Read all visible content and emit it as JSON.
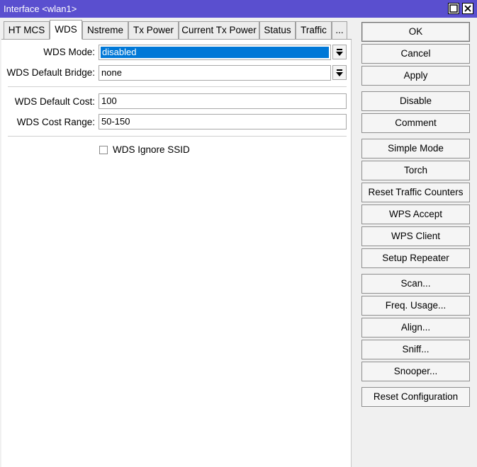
{
  "window": {
    "title": "Interface <wlan1>"
  },
  "title_buttons": {
    "maximize": "maximize-icon",
    "close": "close-icon"
  },
  "tabs": [
    {
      "label": "HT MCS"
    },
    {
      "label": "WDS"
    },
    {
      "label": "Nstreme"
    },
    {
      "label": "Tx Power"
    },
    {
      "label": "Current Tx Power"
    },
    {
      "label": "Status"
    },
    {
      "label": "Traffic"
    },
    {
      "label": "..."
    }
  ],
  "form": {
    "wds_mode": {
      "label": "WDS Mode:",
      "value": "disabled"
    },
    "wds_default_bridge": {
      "label": "WDS Default Bridge:",
      "value": "none"
    },
    "wds_default_cost": {
      "label": "WDS Default Cost:",
      "value": "100"
    },
    "wds_cost_range": {
      "label": "WDS Cost Range:",
      "value": "50-150"
    },
    "wds_ignore_ssid": {
      "label": "WDS Ignore SSID",
      "checked": false
    }
  },
  "buttons": {
    "ok": "OK",
    "cancel": "Cancel",
    "apply": "Apply",
    "disable": "Disable",
    "comment": "Comment",
    "simple_mode": "Simple Mode",
    "torch": "Torch",
    "reset_traffic_counters": "Reset Traffic Counters",
    "wps_accept": "WPS Accept",
    "wps_client": "WPS Client",
    "setup_repeater": "Setup Repeater",
    "scan": "Scan...",
    "freq_usage": "Freq. Usage...",
    "align": "Align...",
    "sniff": "Sniff...",
    "snooper": "Snooper...",
    "reset_configuration": "Reset Configuration"
  },
  "colors": {
    "titlebar": "#5a4fcf",
    "selection": "#0078d7"
  }
}
